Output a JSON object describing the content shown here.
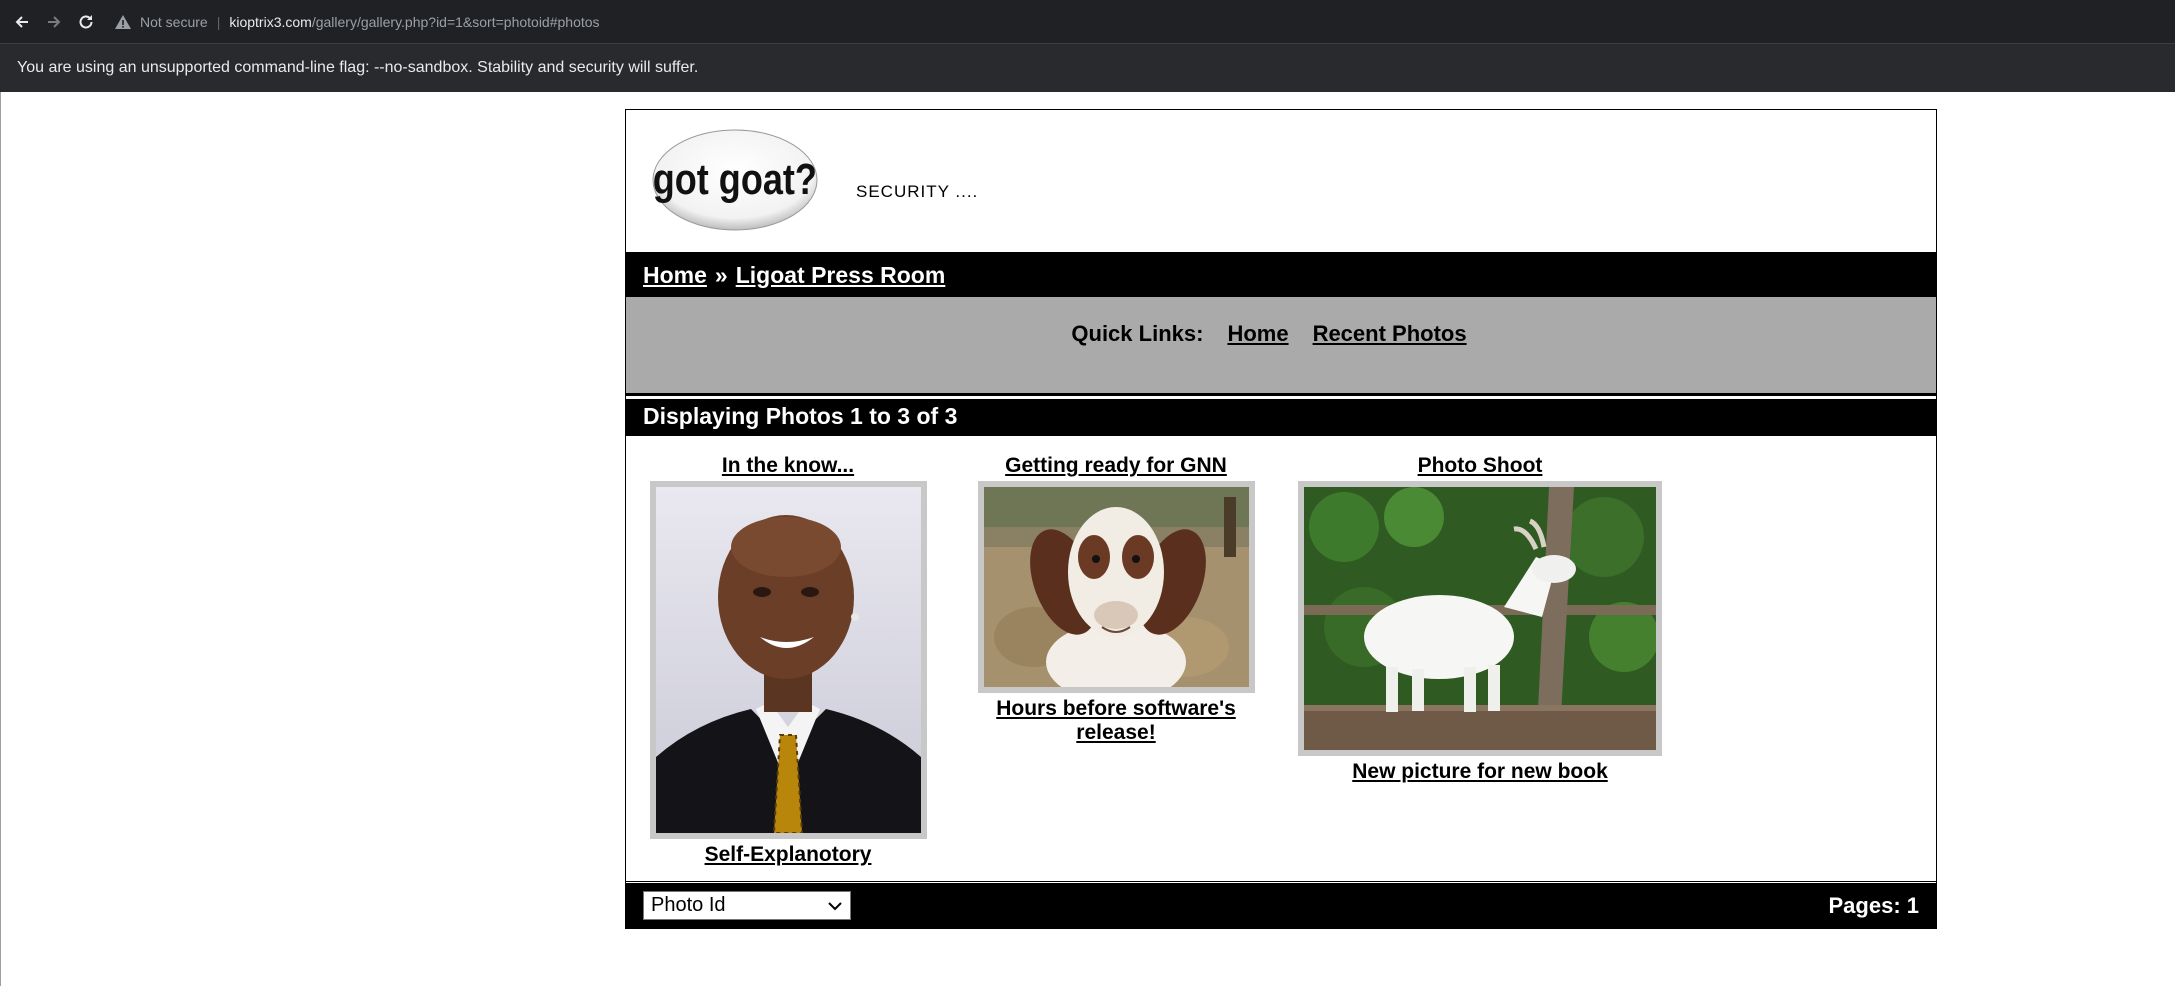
{
  "browser": {
    "not_secure": "Not secure",
    "url_host": "kioptrix3.com",
    "url_path": "/gallery/gallery.php?id=1&sort=photoid#photos",
    "infobar_text": "You are using an unsupported command-line flag: --no-sandbox. Stability and security will suffer."
  },
  "site": {
    "logo_text": "got goat?",
    "tagline": "SECURITY ...."
  },
  "breadcrumb": {
    "home": "Home",
    "separator": "»",
    "current": "Ligoat Press Room"
  },
  "quick_links": {
    "label": "Quick Links:",
    "home": "Home",
    "recent": "Recent Photos"
  },
  "gallery": {
    "heading": "Displaying Photos 1 to 3 of 3",
    "photos": [
      {
        "title": "In the know...",
        "caption": "Self-Explanotory"
      },
      {
        "title": "Getting ready for GNN",
        "caption": "Hours before software's release!"
      },
      {
        "title": "Photo Shoot",
        "caption": "New picture for new book"
      }
    ]
  },
  "footer": {
    "sort_value": "Photo Id",
    "pages": "Pages: 1"
  }
}
